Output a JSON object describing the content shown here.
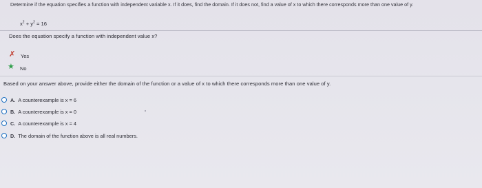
{
  "prompt": "Determine if the equation specifies a function with independent variable x. If it does, find the domain. If it does not, find a value of x to which there corresponds more than one value of y.",
  "equation": {
    "x_base": "x",
    "x_exp": "2",
    "operator": "+",
    "y_base": "y",
    "y_exp": "2",
    "rhs": "= 16"
  },
  "question1": {
    "text": "Does the equation specify a function with independent value x?",
    "answers": [
      {
        "label": "Yes",
        "mark": "incorrect",
        "mark_color": "#c0392b"
      },
      {
        "label": "No",
        "mark": "correct",
        "mark_color": "#2f9e4a"
      }
    ]
  },
  "question2": {
    "text": "Based on your answer above, provide either the domain of the function or a value of x to which there corresponds more than one value of y.",
    "options": [
      {
        "letter": "A.",
        "text": "A counterexample is x = 6"
      },
      {
        "letter": "B.",
        "text": "A counterexample is x = 0"
      },
      {
        "letter": "C.",
        "text": "A counterexample is x = 4"
      },
      {
        "letter": "D.",
        "text": "The domain of the function above is all real numbers."
      }
    ]
  },
  "colors": {
    "radio_border": "#1e6fc0",
    "correct": "#2f9e4a",
    "incorrect": "#c0392b"
  }
}
